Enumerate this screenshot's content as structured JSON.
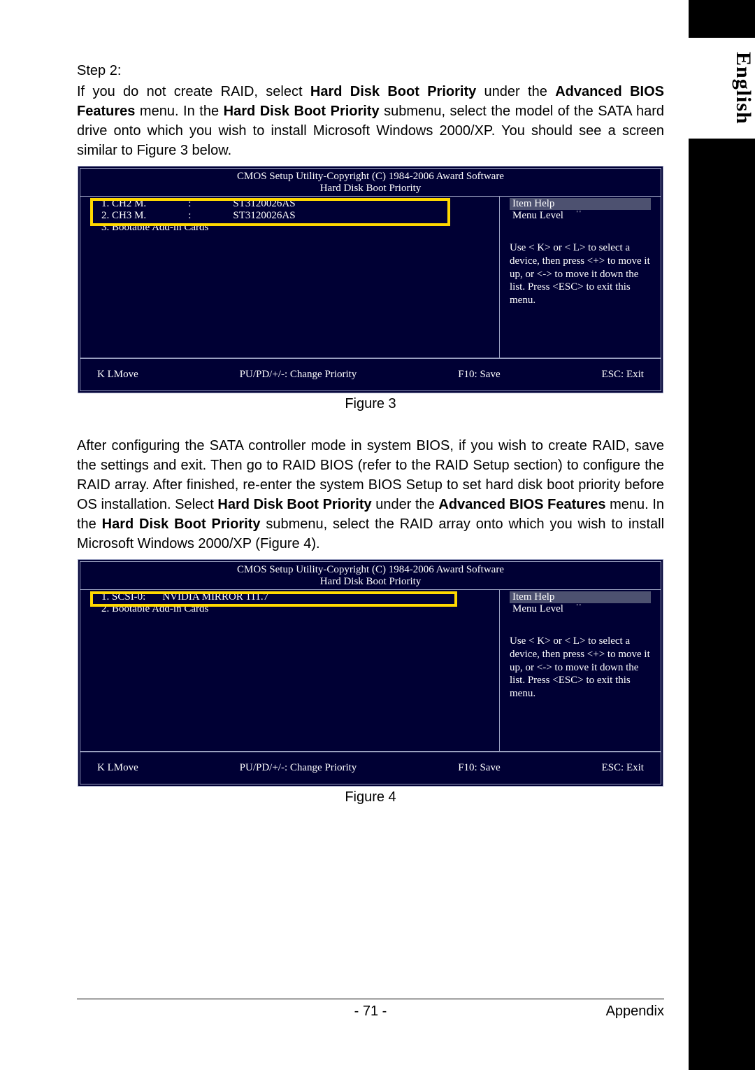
{
  "sideTab": "English",
  "step2": {
    "title": "Step 2:",
    "p1_a": "If you do not create RAID, select ",
    "p1_b": "Hard Disk Boot Priority",
    "p1_c": " under the ",
    "p1_d": "Advanced BIOS Features",
    "p1_e": " menu. In the ",
    "p1_f": "Hard Disk Boot Priority",
    "p1_g": " submenu, select the model of the SATA hard drive onto which you wish to install Microsoft Windows 2000/XP. You should see a screen similar to Figure 3 below."
  },
  "bios": {
    "title": "CMOS Setup Utility-Copyright (C) 1984-2006 Award Software",
    "subtitle": "Hard Disk Boot Priority",
    "help_header": "Item Help",
    "menu_level": "Menu Level",
    "help_text": "Use < K>   or < L> to select a device, then press <+> to move it up, or <-> to move it down the list. Press <ESC> to exit this menu.",
    "footer": {
      "move": "K LMove",
      "change": "PU/PD/+/-: Change Priority",
      "save": "F10: Save",
      "exit": "ESC: Exit"
    }
  },
  "fig3": {
    "rows": [
      {
        "col1": "1. CH2 M.",
        "col2": ":",
        "col3": "ST3120026AS"
      },
      {
        "col1": "2. CH3 M.",
        "col2": ":",
        "col3": "ST3120026AS"
      },
      {
        "col1": "3. Bootable Add-in Cards",
        "col2": "",
        "col3": ""
      }
    ],
    "label": "Figure 3"
  },
  "mid_text": {
    "p_a": "After configuring the SATA controller mode in system BIOS, if you wish to create RAID, save the settings and exit. Then go to RAID BIOS (refer to the RAID Setup section) to configure the RAID array. After finished, re-enter the system BIOS Setup to set hard disk boot priority before OS installation. Select ",
    "p_b": "Hard Disk Boot Priority",
    "p_c": " under the ",
    "p_d": "Advanced BIOS Features",
    "p_e": " menu. In the ",
    "p_f": "Hard Disk Boot Priority",
    "p_g": " submenu, select the RAID array onto which you wish to install Microsoft Windows 2000/XP (Figure 4)."
  },
  "fig4": {
    "rows": [
      {
        "col1": "1. SCSI-0:",
        "col2": "NVIDIA   MIRROR 111.7",
        "col3": ""
      },
      {
        "col1": "2. Bootable Add-in Cards",
        "col2": "",
        "col3": ""
      }
    ],
    "label": "Figure 4"
  },
  "footer": {
    "page": "- 71 -",
    "section": "Appendix"
  }
}
